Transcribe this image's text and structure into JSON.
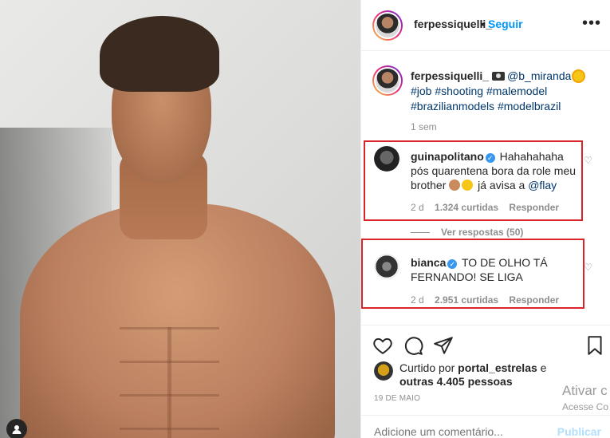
{
  "post": {
    "author": "ferpessiquelli_",
    "separator": "•",
    "follow_label": "Seguir",
    "more_icon": "more-horizontal-icon"
  },
  "caption": {
    "author": "ferpessiquelli_",
    "mention": "@b_miranda",
    "tags_line1": "#job #shooting #malemodel",
    "tags_line2": "#brazilianmodels #modelbrazil",
    "time": "1 sem"
  },
  "comments": [
    {
      "user": "guinapolitano",
      "verified": true,
      "text_line1": "Hahahahaha",
      "text_line2": "pós quarentena bora da role meu",
      "text_line3_a": "brother",
      "text_line3_b": "já avisa a",
      "mention": "@flay",
      "time": "2 d",
      "likes": "1.324 curtidas",
      "reply_label": "Responder"
    },
    {
      "user": "bianca",
      "verified": true,
      "text_line1": "TO DE OLHO TÁ",
      "text_line2": "FERNANDO! SE LIGA",
      "time": "2 d",
      "likes": "2.951 curtidas",
      "reply_label": "Responder"
    }
  ],
  "view_replies": "Ver respostas (50)",
  "likes_summary": {
    "prefix": "Curtido por",
    "user": "portal_estrelas",
    "suffix": "e",
    "line2": "outras 4.405 pessoas"
  },
  "date": "19 DE MAIO",
  "comment_box": {
    "placeholder": "Adicione um comentário...",
    "publish_label": "Publicar"
  },
  "watermark": {
    "line1": "Ativar c",
    "line2": "Acesse Co"
  },
  "colors": {
    "link_blue": "#0095f6",
    "tag_blue": "#00376b",
    "highlight_red": "#d9252a",
    "muted_gray": "#8e8e8e"
  }
}
